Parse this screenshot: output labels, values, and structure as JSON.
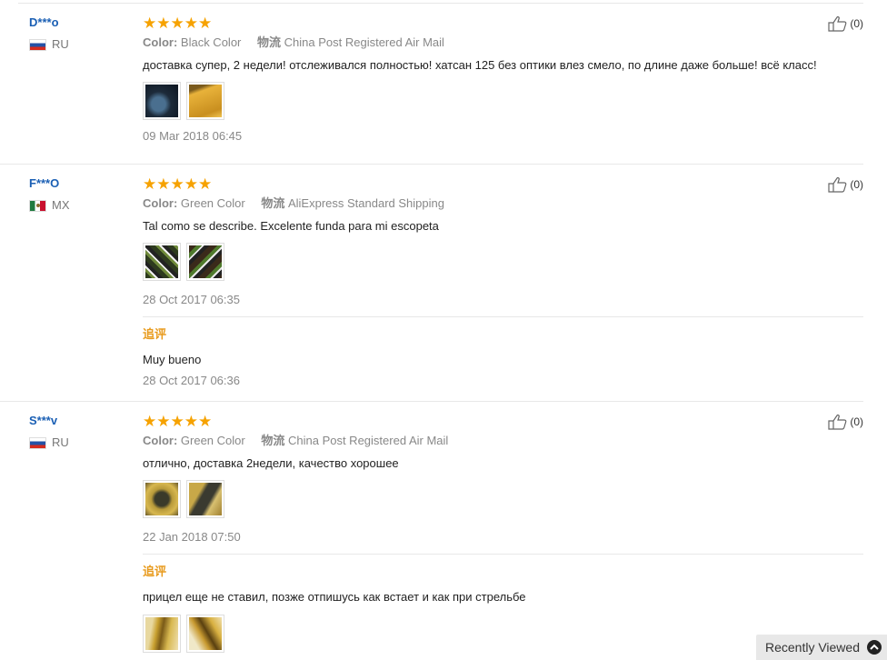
{
  "labels": {
    "color": "Color:",
    "shipping": "物流",
    "reply": "追评",
    "stars": "★★★★★"
  },
  "reviews": [
    {
      "name": "D***o",
      "country": "RU",
      "color": "Black Color",
      "shipping": "China Post Registered Air Mail",
      "text": "доставка супер, 2 недели! отслеживался полностью! хатсан 125 без оптики влез смело, по длине даже больше! всё класс!",
      "date": "09 Mar 2018 06:45",
      "likes": "(0)"
    },
    {
      "name": "F***O",
      "country": "MX",
      "color": "Green Color",
      "shipping": "AliExpress Standard Shipping",
      "text": "Tal como se describe. Excelente funda para mi escopeta",
      "date": "28 Oct 2017 06:35",
      "likes": "(0)",
      "reply_text": "Muy bueno",
      "reply_date": "28 Oct 2017 06:36"
    },
    {
      "name": "S***v",
      "country": "RU",
      "color": "Green Color",
      "shipping": "China Post Registered Air Mail",
      "text": "отлично, доставка 2недели, качество хорошее",
      "date": "22 Jan 2018 07:50",
      "likes": "(0)",
      "reply_text": "прицел еще не ставил, позже отпишусь как встает и как при стрельбе"
    }
  ],
  "recently_viewed": "Recently Viewed",
  "colors": {
    "star": "#f6a200",
    "username": "#1a5fb4",
    "reply_label": "#e89a1c",
    "meta": "#888888"
  }
}
